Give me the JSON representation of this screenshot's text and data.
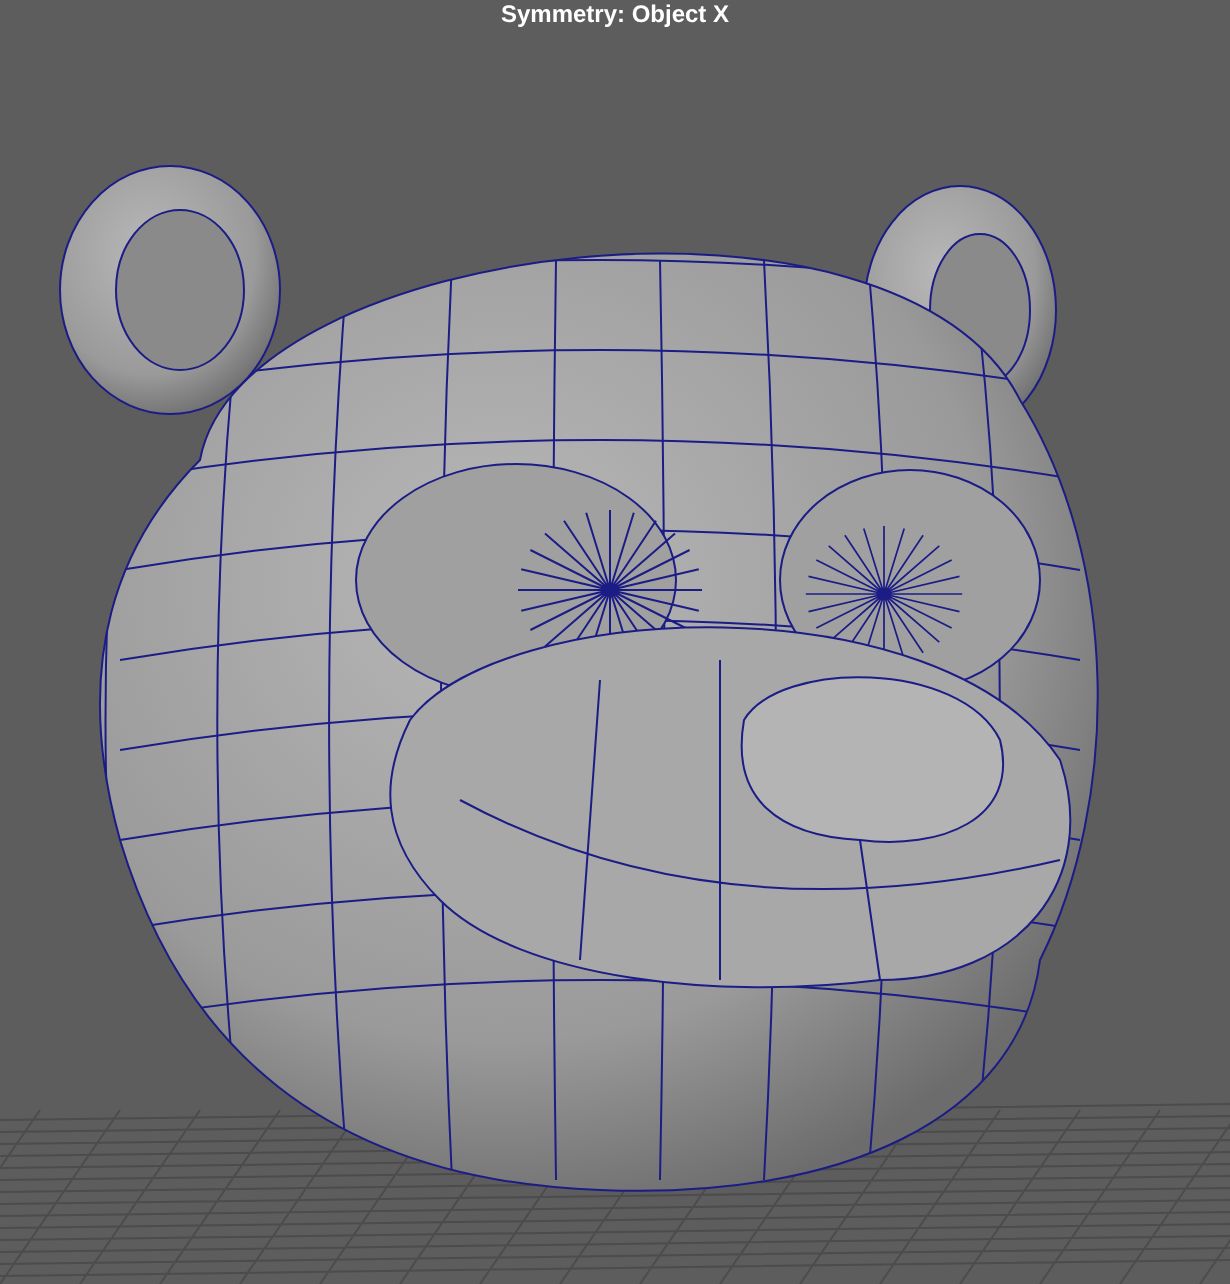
{
  "viewport": {
    "heading": "Symmetry: Object X"
  }
}
